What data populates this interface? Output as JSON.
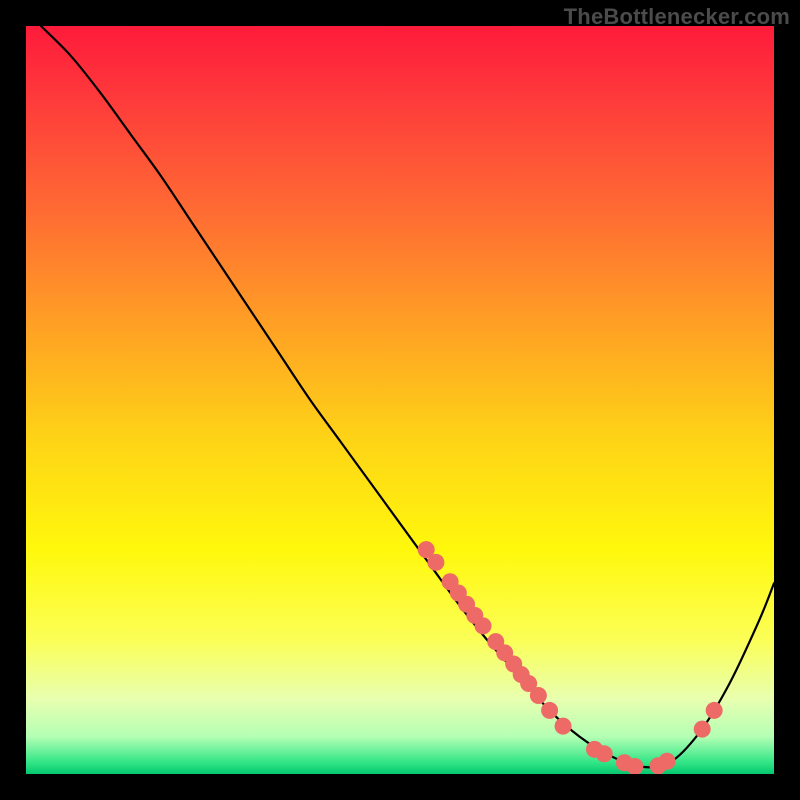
{
  "attribution": "TheBottlenecker.com",
  "chart_data": {
    "type": "line",
    "title": "",
    "xlabel": "",
    "ylabel": "",
    "xlim": [
      0,
      1
    ],
    "ylim": [
      0,
      1
    ],
    "series": [
      {
        "name": "curve",
        "x": [
          0.02,
          0.06,
          0.1,
          0.14,
          0.18,
          0.22,
          0.26,
          0.3,
          0.34,
          0.38,
          0.42,
          0.46,
          0.5,
          0.54,
          0.58,
          0.62,
          0.66,
          0.7,
          0.74,
          0.78,
          0.82,
          0.86,
          0.9,
          0.94,
          0.98,
          1.0
        ],
        "y": [
          1.0,
          0.96,
          0.91,
          0.855,
          0.8,
          0.74,
          0.68,
          0.62,
          0.56,
          0.5,
          0.445,
          0.39,
          0.335,
          0.28,
          0.225,
          0.175,
          0.13,
          0.085,
          0.05,
          0.025,
          0.01,
          0.015,
          0.055,
          0.12,
          0.205,
          0.255
        ]
      }
    ],
    "points": [
      {
        "x": 0.535,
        "y": 0.3
      },
      {
        "x": 0.548,
        "y": 0.283
      },
      {
        "x": 0.567,
        "y": 0.257
      },
      {
        "x": 0.578,
        "y": 0.242
      },
      {
        "x": 0.589,
        "y": 0.227
      },
      {
        "x": 0.6,
        "y": 0.212
      },
      {
        "x": 0.611,
        "y": 0.198
      },
      {
        "x": 0.628,
        "y": 0.177
      },
      {
        "x": 0.64,
        "y": 0.162
      },
      {
        "x": 0.652,
        "y": 0.147
      },
      {
        "x": 0.662,
        "y": 0.133
      },
      {
        "x": 0.672,
        "y": 0.121
      },
      {
        "x": 0.685,
        "y": 0.105
      },
      {
        "x": 0.7,
        "y": 0.085
      },
      {
        "x": 0.718,
        "y": 0.064
      },
      {
        "x": 0.76,
        "y": 0.033
      },
      {
        "x": 0.773,
        "y": 0.027
      },
      {
        "x": 0.8,
        "y": 0.015
      },
      {
        "x": 0.814,
        "y": 0.01
      },
      {
        "x": 0.845,
        "y": 0.011
      },
      {
        "x": 0.857,
        "y": 0.017
      },
      {
        "x": 0.904,
        "y": 0.06
      },
      {
        "x": 0.92,
        "y": 0.085
      }
    ],
    "point_color": "#ed6a66",
    "curve_color": "#000000",
    "background_gradient": {
      "stops": [
        {
          "offset": 0.0,
          "color": "#fe1b3b"
        },
        {
          "offset": 0.1,
          "color": "#fe3b3b"
        },
        {
          "offset": 0.25,
          "color": "#ff6c33"
        },
        {
          "offset": 0.4,
          "color": "#ffa024"
        },
        {
          "offset": 0.55,
          "color": "#fed317"
        },
        {
          "offset": 0.7,
          "color": "#fff80c"
        },
        {
          "offset": 0.82,
          "color": "#fbff56"
        },
        {
          "offset": 0.9,
          "color": "#e8ffb0"
        },
        {
          "offset": 0.95,
          "color": "#b4ffb4"
        },
        {
          "offset": 0.985,
          "color": "#30e586"
        },
        {
          "offset": 1.0,
          "color": "#05c66f"
        }
      ]
    }
  }
}
